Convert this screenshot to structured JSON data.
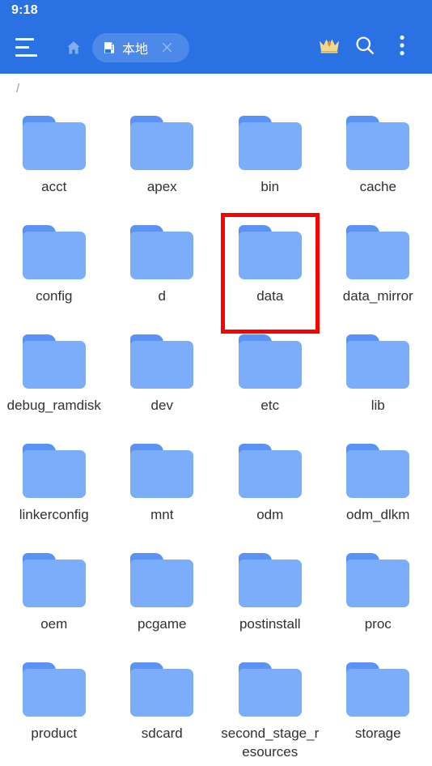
{
  "status_bar": {
    "time": "9:18"
  },
  "app_bar": {
    "menu_icon": "hamburger-menu-icon",
    "home_icon": "home-icon",
    "tab": {
      "icon": "sdcard-storage-icon",
      "label": "本地",
      "close_icon": "close-x-icon"
    },
    "actions": [
      {
        "name": "vip-crown-button",
        "icon": "crown-icon"
      },
      {
        "name": "search-button",
        "icon": "search-icon"
      },
      {
        "name": "more-options-button",
        "icon": "overflow-menu-icon"
      }
    ]
  },
  "breadcrumb": {
    "path": "/"
  },
  "file_grid": {
    "columns": 4,
    "items": [
      {
        "name": "acct",
        "type": "folder"
      },
      {
        "name": "apex",
        "type": "folder"
      },
      {
        "name": "bin",
        "type": "folder"
      },
      {
        "name": "cache",
        "type": "folder"
      },
      {
        "name": "config",
        "type": "folder"
      },
      {
        "name": "d",
        "type": "folder"
      },
      {
        "name": "data",
        "type": "folder",
        "highlighted": true
      },
      {
        "name": "data_mirror",
        "type": "folder"
      },
      {
        "name": "debug_ramdisk",
        "type": "folder"
      },
      {
        "name": "dev",
        "type": "folder"
      },
      {
        "name": "etc",
        "type": "folder"
      },
      {
        "name": "lib",
        "type": "folder"
      },
      {
        "name": "linkerconfig",
        "type": "folder"
      },
      {
        "name": "mnt",
        "type": "folder"
      },
      {
        "name": "odm",
        "type": "folder"
      },
      {
        "name": "odm_dlkm",
        "type": "folder"
      },
      {
        "name": "oem",
        "type": "folder"
      },
      {
        "name": "pcgame",
        "type": "folder"
      },
      {
        "name": "postinstall",
        "type": "folder"
      },
      {
        "name": "proc",
        "type": "folder"
      },
      {
        "name": "product",
        "type": "folder"
      },
      {
        "name": "sdcard",
        "type": "folder"
      },
      {
        "name": "second_stage_resources",
        "type": "folder"
      },
      {
        "name": "storage",
        "type": "folder"
      }
    ]
  },
  "colors": {
    "app_bar": "#2a71e4",
    "folder_tab": "#5a92f5",
    "folder_body": "#7cadfb",
    "highlight": "#fb0000",
    "label_text": "#313131",
    "breadcrumb_text": "#9a9a9a",
    "crown": "#f5d98a"
  }
}
